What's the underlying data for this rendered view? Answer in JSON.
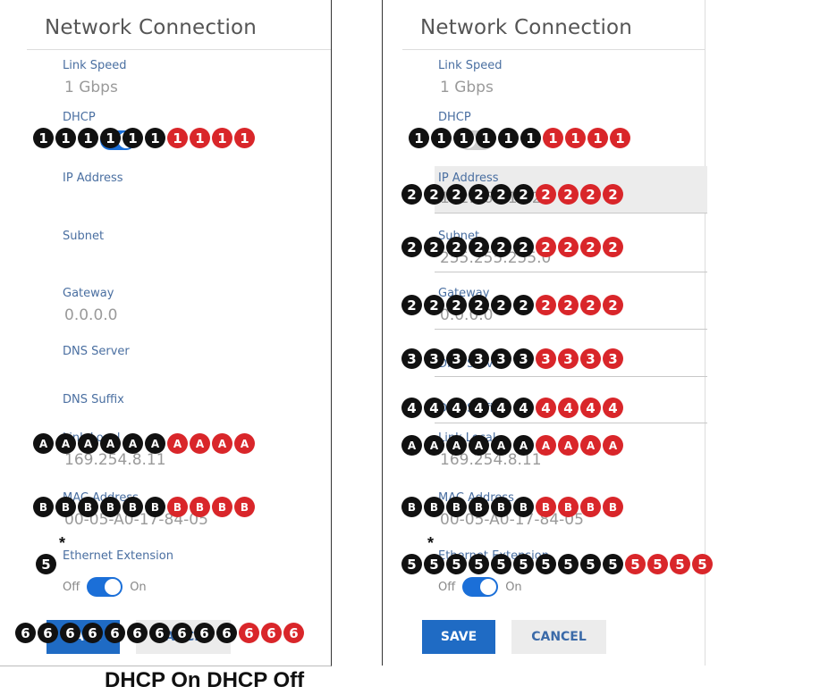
{
  "left_panel": {
    "title": "Network Connection",
    "link_speed_label": "Link Speed",
    "link_speed_value": "1 Gbps",
    "dhcp_label": "DHCP",
    "ip_label": "IP Address",
    "subnet_label": "Subnet",
    "gateway_label": "Gateway",
    "gateway_value": "0.0.0.0",
    "dns_server_label": "DNS Server",
    "dns_suffix_label": "DNS Suffix",
    "link_local_label": "Link Local",
    "link_local_value": "169.254.8.11",
    "mac_label": "MAC Address",
    "mac_value": "00-05-A0-17-84-05",
    "ethernet_label": "Ethernet Extension",
    "off_label": "Off",
    "on_label": "On",
    "save_label": "SAVE",
    "cancel_label": "CANCEL"
  },
  "right_panel": {
    "title": "Network Connection",
    "link_speed_label": "Link Speed",
    "link_speed_value": "1 Gbps",
    "dhcp_label": "DHCP",
    "ip_label": "IP Address",
    "ip_value": "192.168.1.22",
    "subnet_label": "Subnet",
    "subnet_value": "255.255.255.0",
    "gateway_label": "Gateway",
    "gateway_value": "0.0.0.0",
    "dns_server_label": "DNS Server",
    "dns_suffix_label": "DNS Suffix",
    "link_local_label": "Link Local",
    "link_local_value": "169.254.8.11",
    "mac_label": "MAC Address",
    "mac_value": "00-05-A0-17-84-05",
    "ethernet_label": "Ethernet Extension",
    "off_label": "Off",
    "on_label": "On",
    "save_label": "SAVE",
    "cancel_label": "CANCEL"
  },
  "marker_rows": {
    "left": [
      {
        "symbol": "1",
        "black": 6,
        "red": 4
      },
      {
        "symbol": "A",
        "black": 6,
        "red": 4
      },
      {
        "symbol": "B",
        "black": 6,
        "red": 4
      },
      {
        "symbol": "5",
        "black": 1,
        "red": 0
      },
      {
        "symbol": "6",
        "black": 10,
        "red": 3
      }
    ],
    "right": [
      {
        "symbol": "1",
        "black": 6,
        "red": 4
      },
      {
        "symbol": "2",
        "black": 6,
        "red": 4
      },
      {
        "symbol": "2",
        "black": 6,
        "red": 4
      },
      {
        "symbol": "2",
        "black": 6,
        "red": 4
      },
      {
        "symbol": "3",
        "black": 6,
        "red": 4
      },
      {
        "symbol": "4",
        "black": 6,
        "red": 4
      },
      {
        "symbol": "A",
        "black": 6,
        "red": 4
      },
      {
        "symbol": "B",
        "black": 6,
        "red": 4
      },
      {
        "symbol": "5",
        "black": 10,
        "red": 4
      }
    ]
  },
  "asterisk": "*",
  "caption": "DHCP On DHCP Off",
  "colors": {
    "marker_black": "#111111",
    "marker_red": "#d9262a",
    "accent_blue": "#1b6fd8"
  }
}
